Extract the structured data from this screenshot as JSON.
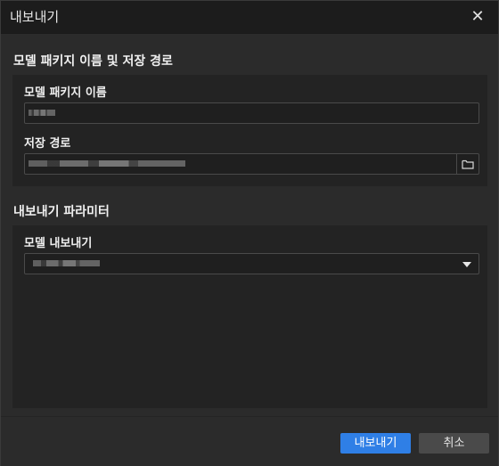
{
  "window": {
    "title": "내보내기",
    "close_icon": "close-icon"
  },
  "package_section": {
    "title": "모델 패키지 이름 및 저장 경로",
    "name_label": "모델 패키지 이름",
    "name_value": "",
    "path_label": "저장 경로",
    "path_value": "",
    "browse_icon": "folder-icon"
  },
  "params_section": {
    "title": "내보내기 파라미터",
    "model_export_label": "모델 내보내기",
    "model_export_value": "",
    "dropdown_icon": "caret-down-icon"
  },
  "buttons": {
    "export_label": "내보내기",
    "cancel_label": "취소"
  },
  "colors": {
    "accent": "#2f7fe6",
    "background": "#2b2b2b",
    "panel": "#232323"
  }
}
